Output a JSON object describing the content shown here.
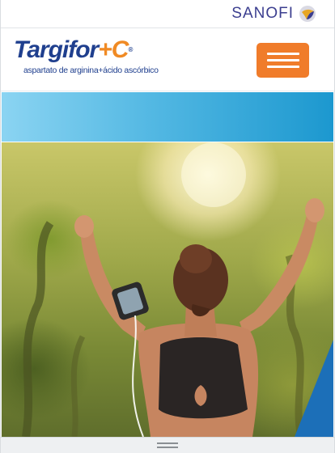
{
  "corporate": {
    "brand": "SANOFI",
    "brand_color": "#3b3e8f"
  },
  "logo": {
    "name": "Targifor",
    "plus": "+",
    "letter": "C",
    "registered": "®",
    "subtitle": "aspartato de arginina+ácido ascórbico",
    "name_color": "#1f3f8e",
    "accent_color": "#f08a24"
  },
  "header": {
    "menu_icon": "hamburger-menu-icon",
    "menu_color": "#f07c2a"
  },
  "band": {
    "colors": [
      "#8bd4f2",
      "#1c98cf"
    ]
  },
  "hero": {
    "image": "woman-raising-arms-in-sunlit-forest"
  }
}
